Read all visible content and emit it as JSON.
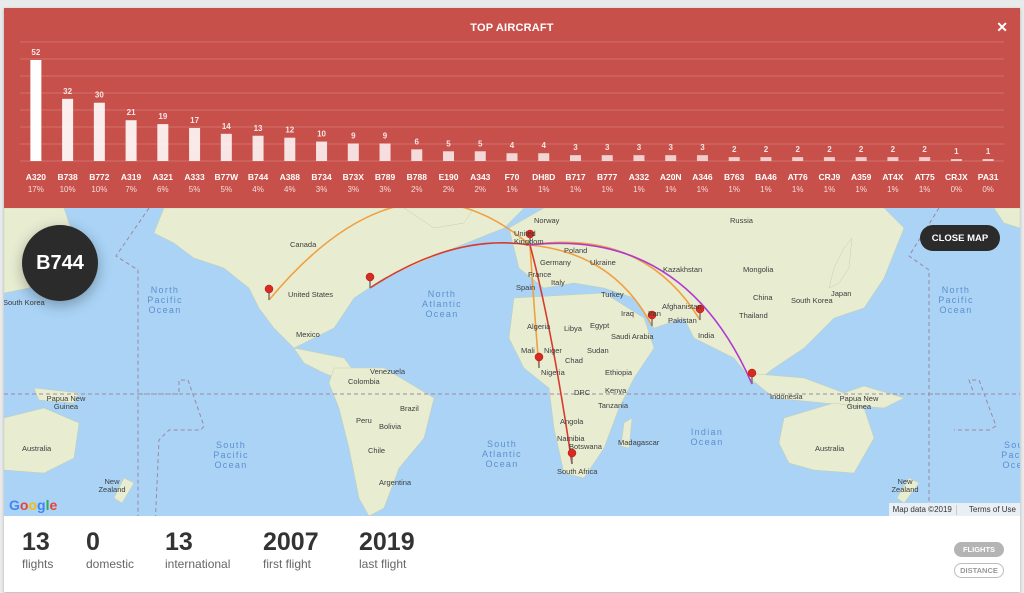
{
  "chart_data": {
    "type": "bar",
    "title": "TOP AIRCRAFT",
    "categories": [
      "A320",
      "B738",
      "B772",
      "A319",
      "A321",
      "A333",
      "B77W",
      "B744",
      "A388",
      "B734",
      "B73X",
      "B789",
      "B788",
      "E190",
      "A343",
      "F70",
      "DH8D",
      "B717",
      "B777",
      "A332",
      "A20N",
      "A346",
      "B763",
      "BA46",
      "AT76",
      "CRJ9",
      "A359",
      "AT4X",
      "AT75",
      "CRJX",
      "PA31"
    ],
    "values": [
      52,
      32,
      30,
      21,
      19,
      17,
      14,
      13,
      12,
      10,
      9,
      9,
      6,
      5,
      5,
      4,
      4,
      3,
      3,
      3,
      3,
      3,
      2,
      2,
      2,
      2,
      2,
      2,
      2,
      1,
      1
    ],
    "percentages": [
      "17%",
      "10%",
      "10%",
      "7%",
      "6%",
      "5%",
      "5%",
      "4%",
      "4%",
      "3%",
      "3%",
      "3%",
      "2%",
      "2%",
      "2%",
      "1%",
      "1%",
      "1%",
      "1%",
      "1%",
      "1%",
      "1%",
      "1%",
      "1%",
      "1%",
      "1%",
      "1%",
      "1%",
      "1%",
      "0%",
      "0%"
    ],
    "ylim": [
      0,
      60
    ],
    "grid": true,
    "xlabel": "",
    "ylabel": ""
  },
  "header": {
    "title": "TOP AIRCRAFT",
    "close_icon": "close-x-icon"
  },
  "map": {
    "selected_aircraft": "B744",
    "close_map_label": "CLOSE MAP",
    "google_logo": "Google",
    "map_data": "Map data ©2019",
    "terms": "Terms of Use",
    "country_labels": {
      "canada": "Canada",
      "united_states": "United States",
      "mexico": "Mexico",
      "south_korea_left": "South Korea",
      "norway": "Norway",
      "united_kingdom": "United Kingdom",
      "poland": "Poland",
      "germany": "Germany",
      "ukraine": "Ukraine",
      "france": "France",
      "spain": "Spain",
      "italy": "Italy",
      "turkey": "Turkey",
      "iraq": "Iraq",
      "iran": "Iran",
      "algeria": "Algeria",
      "libya": "Libya",
      "egypt": "Egypt",
      "saudi_arabia": "Saudi Arabia",
      "mali": "Mali",
      "niger": "Niger",
      "chad": "Chad",
      "sudan": "Sudan",
      "nigeria": "Nigeria",
      "ethiopia": "Ethiopia",
      "drc": "DRC",
      "kenya": "Kenya",
      "tanzania": "Tanzania",
      "angola": "Angola",
      "namibia": "Namibia",
      "botswana": "Botswana",
      "madagascar": "Madagascar",
      "south_africa": "South Africa",
      "russia": "Russia",
      "kazakhstan": "Kazakhstan",
      "mongolia": "Mongolia",
      "china": "China",
      "afghanistan": "Afghanistan",
      "pakistan": "Pakistan",
      "india": "India",
      "thailand": "Thailand",
      "south_korea_right": "South Korea",
      "japan": "Japan",
      "indonesia": "Indonesia",
      "papua_new_guinea_left": "Papua New Guinea",
      "papua_new_guinea_right": "Papua New Guinea",
      "australia_left": "Australia",
      "australia_right": "Australia",
      "new_zealand_left": "New Zealand",
      "new_zealand_right": "New Zealand",
      "venezuela": "Venezuela",
      "colombia": "Colombia",
      "peru": "Peru",
      "brazil": "Brazil",
      "bolivia": "Bolivia",
      "chile": "Chile",
      "argentina": "Argentina"
    },
    "ocean_labels": {
      "north_pacific_left": "North Pacific Ocean",
      "north_atlantic": "North Atlantic Ocean",
      "north_pacific_right": "North Pacific Ocean",
      "south_pacific_left": "South Pacific Ocean",
      "south_atlantic": "South Atlantic Ocean",
      "indian": "Indian Ocean",
      "south_pacific_right": "South Pacific Ocean"
    },
    "route_colors": {
      "red": "#d83b2d",
      "orange": "#f0a040",
      "purple": "#b03ad0"
    }
  },
  "stats": {
    "flights": {
      "value": "13",
      "label": "flights"
    },
    "domestic": {
      "value": "0",
      "label": "domestic"
    },
    "international": {
      "value": "13",
      "label": "international"
    },
    "first_flight": {
      "value": "2007",
      "label": "first flight"
    },
    "last_flight": {
      "value": "2019",
      "label": "last flight"
    }
  },
  "toggle": {
    "flights_label": "FLIGHTS",
    "distance_label": "DISTANCE"
  },
  "colors": {
    "chart_bg": "#c8504a",
    "badge_bg": "#2b2b2b",
    "ocean": "#aad3f5",
    "land": "#f4efd9"
  }
}
